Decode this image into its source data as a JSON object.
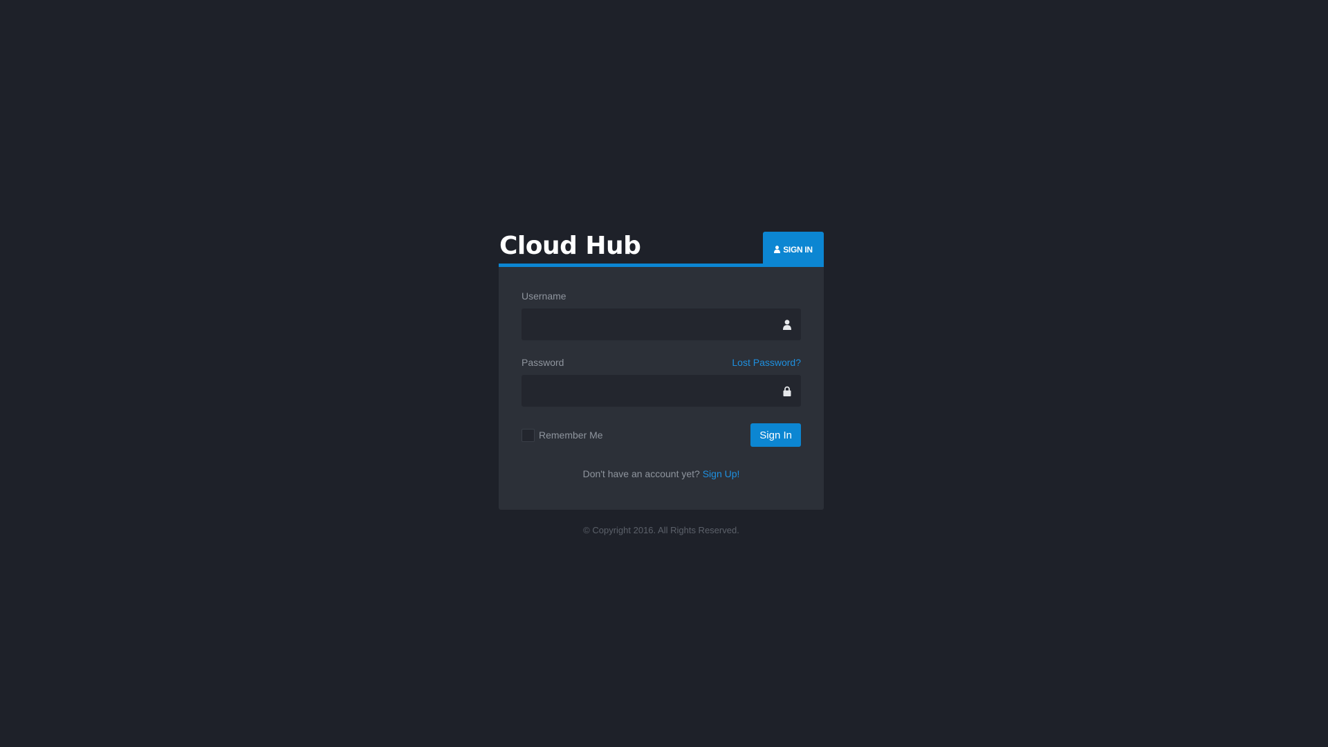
{
  "brand": {
    "title": "Cloud Hub"
  },
  "header": {
    "tab_label": "SIGN IN",
    "tab_icon": "user-icon",
    "accent_color": "#0c86d2"
  },
  "form": {
    "username": {
      "label": "Username",
      "value": "",
      "placeholder": "",
      "icon": "user-icon"
    },
    "password": {
      "label": "Password",
      "value": "",
      "placeholder": "",
      "icon": "lock-icon",
      "lost_link": "Lost Password?"
    },
    "remember_label": "Remember Me",
    "remember_checked": false,
    "submit_label": "Sign In"
  },
  "signup": {
    "prompt": "Don't have an account yet?",
    "link": "Sign Up!"
  },
  "footer": {
    "copyright": "© Copyright 2016. All Rights Reserved."
  }
}
